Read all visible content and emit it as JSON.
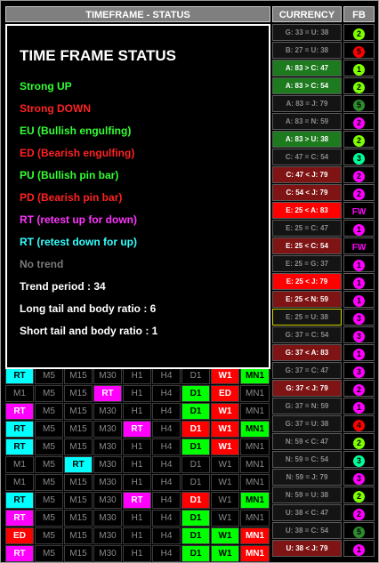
{
  "header": {
    "timeframe_status": "TIMEFRAME -  STATUS",
    "currency": "CURRENCY",
    "fb": "FB"
  },
  "colors": {
    "strong_up": "#00ff00",
    "strong_down": "#ff0000",
    "bull_engulf": "#00ff00",
    "bear_engulf": "#ff0000",
    "bull_pinbar": "#00ff00",
    "bear_pinbar": "#ff0000",
    "retest_up": "#ff00ff",
    "retest_down": "#00ffff",
    "no_trend": "#808080"
  },
  "legend": {
    "title": "TIME FRAME STATUS",
    "items": [
      {
        "text": "Strong UP",
        "color": "#33ff33"
      },
      {
        "text": "Strong DOWN",
        "color": "#ff2222"
      },
      {
        "text": "EU (Bullish engulfing)",
        "color": "#33ff33"
      },
      {
        "text": "ED (Bearish engulfing)",
        "color": "#ff2222"
      },
      {
        "text": "PU (Bullish pin bar)",
        "color": "#33ff33"
      },
      {
        "text": "PD (Bearish pin bar)",
        "color": "#ff2222"
      },
      {
        "text": "RT (retest up for down)",
        "color": "#ff33ff"
      },
      {
        "text": "RT (retest down for up)",
        "color": "#33ffff"
      },
      {
        "text": "No trend",
        "color": "#7a7a7a"
      },
      {
        "text": "Trend period : 34",
        "color": "#ffffff"
      },
      {
        "text": "Long tail and body ratio : 6",
        "color": "#ffffff"
      },
      {
        "text": "Short tail and body ratio : 1",
        "color": "#ffffff"
      }
    ]
  },
  "timeframe_rows": [
    [
      {
        "t": "RT",
        "s": "rtd"
      },
      {
        "t": "M5",
        "s": "off"
      },
      {
        "t": "M15",
        "s": "off"
      },
      {
        "t": "M30",
        "s": "off"
      },
      {
        "t": "H1",
        "s": "off"
      },
      {
        "t": "H4",
        "s": "off"
      },
      {
        "t": "D1",
        "s": "off"
      },
      {
        "t": "W1",
        "s": "dn"
      },
      {
        "t": "MN1",
        "s": "up"
      }
    ],
    [
      {
        "t": "M1",
        "s": "off"
      },
      {
        "t": "M5",
        "s": "off"
      },
      {
        "t": "M15",
        "s": "off"
      },
      {
        "t": "RT",
        "s": "rtu"
      },
      {
        "t": "H1",
        "s": "off"
      },
      {
        "t": "H4",
        "s": "off"
      },
      {
        "t": "D1",
        "s": "up"
      },
      {
        "t": "ED",
        "s": "ed"
      },
      {
        "t": "MN1",
        "s": "off"
      }
    ],
    [
      {
        "t": "RT",
        "s": "rtu"
      },
      {
        "t": "M5",
        "s": "off"
      },
      {
        "t": "M15",
        "s": "off"
      },
      {
        "t": "M30",
        "s": "off"
      },
      {
        "t": "H1",
        "s": "off"
      },
      {
        "t": "H4",
        "s": "off"
      },
      {
        "t": "D1",
        "s": "up"
      },
      {
        "t": "W1",
        "s": "dn"
      },
      {
        "t": "MN1",
        "s": "off"
      }
    ],
    [
      {
        "t": "RT",
        "s": "rtd"
      },
      {
        "t": "M5",
        "s": "off"
      },
      {
        "t": "M15",
        "s": "off"
      },
      {
        "t": "M30",
        "s": "off"
      },
      {
        "t": "RT",
        "s": "rtu"
      },
      {
        "t": "H4",
        "s": "off"
      },
      {
        "t": "D1",
        "s": "dn"
      },
      {
        "t": "W1",
        "s": "dn"
      },
      {
        "t": "MN1",
        "s": "up"
      }
    ],
    [
      {
        "t": "RT",
        "s": "rtd"
      },
      {
        "t": "M5",
        "s": "off"
      },
      {
        "t": "M15",
        "s": "off"
      },
      {
        "t": "M30",
        "s": "off"
      },
      {
        "t": "H1",
        "s": "off"
      },
      {
        "t": "H4",
        "s": "off"
      },
      {
        "t": "D1",
        "s": "up"
      },
      {
        "t": "W1",
        "s": "dn"
      },
      {
        "t": "MN1",
        "s": "off"
      }
    ],
    [
      {
        "t": "M1",
        "s": "off"
      },
      {
        "t": "M5",
        "s": "off"
      },
      {
        "t": "RT",
        "s": "rtd"
      },
      {
        "t": "M30",
        "s": "off"
      },
      {
        "t": "H1",
        "s": "off"
      },
      {
        "t": "H4",
        "s": "off"
      },
      {
        "t": "D1",
        "s": "off"
      },
      {
        "t": "W1",
        "s": "off"
      },
      {
        "t": "MN1",
        "s": "off"
      }
    ],
    [
      {
        "t": "M1",
        "s": "off"
      },
      {
        "t": "M5",
        "s": "off"
      },
      {
        "t": "M15",
        "s": "off"
      },
      {
        "t": "M30",
        "s": "off"
      },
      {
        "t": "H1",
        "s": "off"
      },
      {
        "t": "H4",
        "s": "off"
      },
      {
        "t": "D1",
        "s": "off"
      },
      {
        "t": "W1",
        "s": "off"
      },
      {
        "t": "MN1",
        "s": "off"
      }
    ],
    [
      {
        "t": "RT",
        "s": "rtd"
      },
      {
        "t": "M5",
        "s": "off"
      },
      {
        "t": "M15",
        "s": "off"
      },
      {
        "t": "M30",
        "s": "off"
      },
      {
        "t": "RT",
        "s": "rtu"
      },
      {
        "t": "H4",
        "s": "off"
      },
      {
        "t": "D1",
        "s": "dn"
      },
      {
        "t": "W1",
        "s": "off"
      },
      {
        "t": "MN1",
        "s": "up"
      }
    ],
    [
      {
        "t": "RT",
        "s": "rtu"
      },
      {
        "t": "M5",
        "s": "off"
      },
      {
        "t": "M15",
        "s": "off"
      },
      {
        "t": "M30",
        "s": "off"
      },
      {
        "t": "H1",
        "s": "off"
      },
      {
        "t": "H4",
        "s": "off"
      },
      {
        "t": "D1",
        "s": "up"
      },
      {
        "t": "W1",
        "s": "off"
      },
      {
        "t": "MN1",
        "s": "off"
      }
    ],
    [
      {
        "t": "ED",
        "s": "ed"
      },
      {
        "t": "M5",
        "s": "off"
      },
      {
        "t": "M15",
        "s": "off"
      },
      {
        "t": "M30",
        "s": "off"
      },
      {
        "t": "H1",
        "s": "off"
      },
      {
        "t": "H4",
        "s": "off"
      },
      {
        "t": "D1",
        "s": "up"
      },
      {
        "t": "W1",
        "s": "up"
      },
      {
        "t": "MN1",
        "s": "dn"
      }
    ],
    [
      {
        "t": "RT",
        "s": "rtu"
      },
      {
        "t": "M5",
        "s": "off"
      },
      {
        "t": "M15",
        "s": "off"
      },
      {
        "t": "M30",
        "s": "off"
      },
      {
        "t": "H1",
        "s": "off"
      },
      {
        "t": "H4",
        "s": "off"
      },
      {
        "t": "D1",
        "s": "up"
      },
      {
        "t": "W1",
        "s": "up"
      },
      {
        "t": "MN1",
        "s": "dn"
      }
    ]
  ],
  "currency_rows": [
    {
      "text": "G: 33 = U: 38",
      "bg": "#141414",
      "fg": "#8a8a8a",
      "border": "#5a5a5a",
      "fb": "2",
      "fb_color": "#7fff00"
    },
    {
      "text": "B: 27 = U: 38",
      "bg": "#141414",
      "fg": "#8a8a8a",
      "border": "#5a5a5a",
      "fb": "5",
      "fb_color": "#ff0000"
    },
    {
      "text": "A: 83 > C: 47",
      "bg": "#1e7a1e",
      "fg": "#ffffff",
      "border": "#5a5a5a",
      "fb": "1",
      "fb_color": "#7fff00"
    },
    {
      "text": "A: 83 > C: 54",
      "bg": "#1e7a1e",
      "fg": "#ffffff",
      "border": "#5a5a5a",
      "fb": "2",
      "fb_color": "#7fff00"
    },
    {
      "text": "A: 83 = J: 79",
      "bg": "#141414",
      "fg": "#8a8a8a",
      "border": "#5a5a5a",
      "fb": "5",
      "fb_color": "#2e8b2e"
    },
    {
      "text": "A: 83 = N: 59",
      "bg": "#141414",
      "fg": "#8a8a8a",
      "border": "#5a5a5a",
      "fb": "2",
      "fb_color": "#ff00ff"
    },
    {
      "text": "A: 83 > U: 38",
      "bg": "#1e7a1e",
      "fg": "#ffffff",
      "border": "#5a5a5a",
      "fb": "2",
      "fb_color": "#7fff00"
    },
    {
      "text": "C: 47 = C: 54",
      "bg": "#141414",
      "fg": "#8a8a8a",
      "border": "#5a5a5a",
      "fb": "3",
      "fb_color": "#00ff99"
    },
    {
      "text": "C: 47 < J: 79",
      "bg": "#7f1414",
      "fg": "#ffffff",
      "border": "#5a5a5a",
      "fb": "2",
      "fb_color": "#ff00ff"
    },
    {
      "text": "C: 54 < J: 79",
      "bg": "#7f1414",
      "fg": "#ffffff",
      "border": "#5a5a5a",
      "fb": "2",
      "fb_color": "#ff00ff"
    },
    {
      "text": "E: 25 < A: 83",
      "bg": "#ff0000",
      "fg": "#ffffff",
      "border": "#5a5a5a",
      "fb": "FW",
      "fb_color": "#ff00ff"
    },
    {
      "text": "E: 25 = C: 47",
      "bg": "#141414",
      "fg": "#8a8a8a",
      "border": "#5a5a5a",
      "fb": "1",
      "fb_color": "#ff00ff"
    },
    {
      "text": "E: 25 < C: 54",
      "bg": "#7f1414",
      "fg": "#ffffff",
      "border": "#5a5a5a",
      "fb": "FW",
      "fb_color": "#ff00ff"
    },
    {
      "text": "E: 25 = G: 37",
      "bg": "#141414",
      "fg": "#8a8a8a",
      "border": "#5a5a5a",
      "fb": "1",
      "fb_color": "#ff00ff"
    },
    {
      "text": "E: 25 < J: 79",
      "bg": "#ff0000",
      "fg": "#ffffff",
      "border": "#5a5a5a",
      "fb": "1",
      "fb_color": "#ff00ff"
    },
    {
      "text": "E: 25 < N: 59",
      "bg": "#7f1414",
      "fg": "#ffffff",
      "border": "#5a5a5a",
      "fb": "1",
      "fb_color": "#ff00ff"
    },
    {
      "text": "E: 25 = U: 38",
      "bg": "#141414",
      "fg": "#8a8a8a",
      "border": "#d4d400",
      "fb": "3",
      "fb_color": "#ff00ff"
    },
    {
      "text": "G: 37 = C: 54",
      "bg": "#141414",
      "fg": "#8a8a8a",
      "border": "#5a5a5a",
      "fb": "3",
      "fb_color": "#ff00ff"
    },
    {
      "text": "G: 37 < A: 83",
      "bg": "#7f1414",
      "fg": "#ffffff",
      "border": "#5a5a5a",
      "fb": "1",
      "fb_color": "#ff00ff"
    },
    {
      "text": "G: 37 = C: 47",
      "bg": "#141414",
      "fg": "#8a8a8a",
      "border": "#5a5a5a",
      "fb": "3",
      "fb_color": "#ff00ff"
    },
    {
      "text": "G: 37 < J: 79",
      "bg": "#7f1414",
      "fg": "#ffffff",
      "border": "#5a5a5a",
      "fb": "2",
      "fb_color": "#ff00ff"
    },
    {
      "text": "G: 37 = N: 59",
      "bg": "#141414",
      "fg": "#8a8a8a",
      "border": "#5a5a5a",
      "fb": "1",
      "fb_color": "#ff00ff"
    },
    {
      "text": "G: 37 = U: 38",
      "bg": "#141414",
      "fg": "#8a8a8a",
      "border": "#5a5a5a",
      "fb": "4",
      "fb_color": "#ff0000"
    },
    {
      "text": "N: 59 < C: 47",
      "bg": "#141414",
      "fg": "#8a8a8a",
      "border": "#5a5a5a",
      "fb": "2",
      "fb_color": "#7fff00"
    },
    {
      "text": "N: 59 = C: 54",
      "bg": "#141414",
      "fg": "#8a8a8a",
      "border": "#5a5a5a",
      "fb": "3",
      "fb_color": "#00ff99"
    },
    {
      "text": "N: 59 = J: 79",
      "bg": "#141414",
      "fg": "#8a8a8a",
      "border": "#5a5a5a",
      "fb": "3",
      "fb_color": "#ff00ff"
    },
    {
      "text": "N: 59 = U: 38",
      "bg": "#141414",
      "fg": "#8a8a8a",
      "border": "#5a5a5a",
      "fb": "2",
      "fb_color": "#7fff00"
    },
    {
      "text": "U: 38 < C: 47",
      "bg": "#141414",
      "fg": "#8a8a8a",
      "border": "#5a5a5a",
      "fb": "2",
      "fb_color": "#ff00ff"
    },
    {
      "text": "U: 38 = C: 54",
      "bg": "#141414",
      "fg": "#8a8a8a",
      "border": "#5a5a5a",
      "fb": "5",
      "fb_color": "#2e8b2e"
    },
    {
      "text": "U: 38 < J: 79",
      "bg": "#7f1414",
      "fg": "#ffffff",
      "border": "#5a5a5a",
      "fb": "1",
      "fb_color": "#ff00ff"
    }
  ]
}
